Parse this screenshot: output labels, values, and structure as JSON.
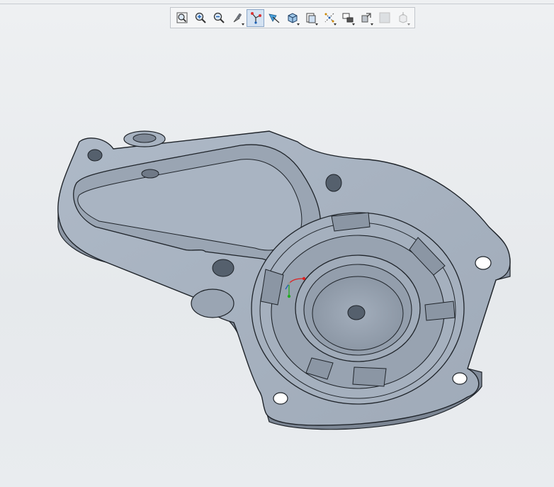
{
  "toolbar": {
    "buttons": [
      {
        "name": "refit-icon",
        "has_dropdown": false
      },
      {
        "name": "zoom-in-icon",
        "has_dropdown": false
      },
      {
        "name": "zoom-out-icon",
        "has_dropdown": false
      },
      {
        "name": "repaint-icon",
        "has_dropdown": true
      },
      {
        "name": "datum-display-icon",
        "has_dropdown": false,
        "active": true
      },
      {
        "name": "spin-center-icon",
        "has_dropdown": false
      },
      {
        "name": "display-style-icon",
        "has_dropdown": true
      },
      {
        "name": "saved-orientations-icon",
        "has_dropdown": true
      },
      {
        "name": "datum-points-icon",
        "has_dropdown": true
      },
      {
        "name": "view-manager-icon",
        "has_dropdown": true
      },
      {
        "name": "annotation-display-icon",
        "has_dropdown": true
      },
      {
        "name": "section-view-icon",
        "has_dropdown": false,
        "disabled": true
      },
      {
        "name": "view-normal-icon",
        "has_dropdown": true,
        "disabled": true
      }
    ]
  },
  "model": {
    "name": "gear-housing-cover-part",
    "part_color": "#a9b5c3",
    "edge_color": "#1f242a"
  }
}
